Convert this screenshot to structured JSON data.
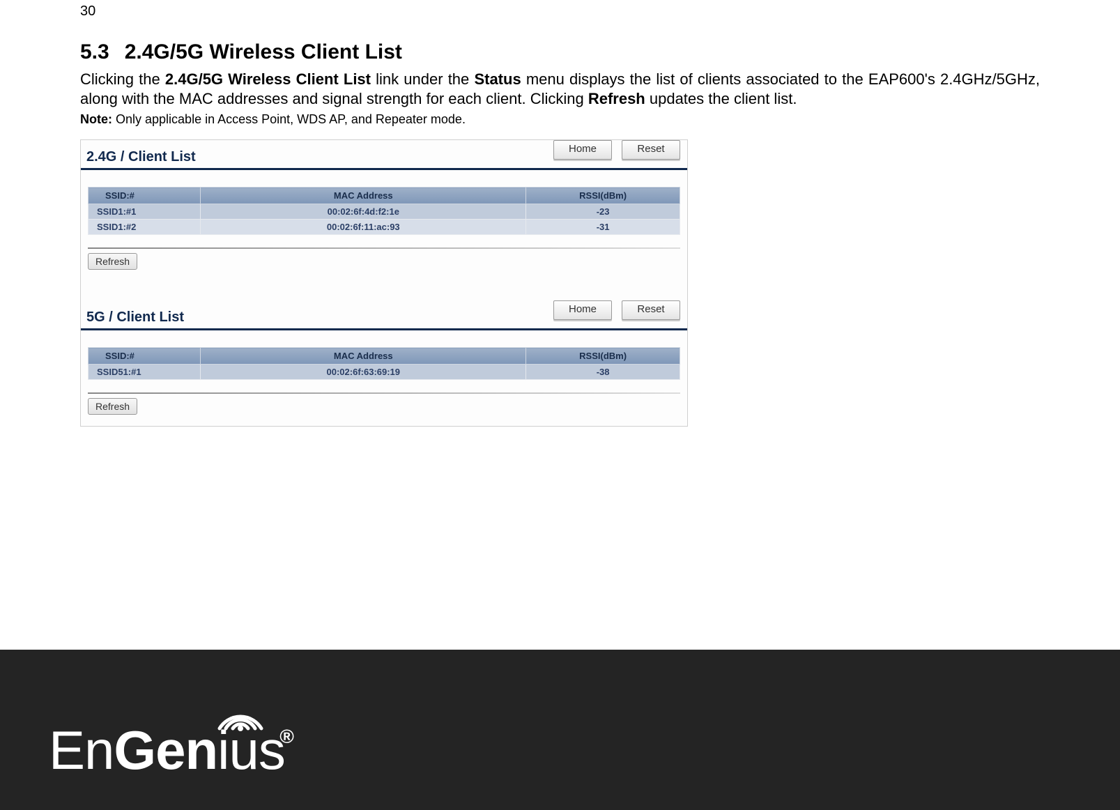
{
  "page_number": "30",
  "heading": {
    "num": "5.3",
    "title": "2.4G/5G Wireless Client List"
  },
  "body": {
    "p1a": "Clicking the ",
    "p1b": "2.4G/5G Wireless Client List",
    "p1c": " link under the ",
    "p1d": "Status",
    "p1e": " menu displays the list of clients associated to the EAP600's 2.4GHz/5GHz, along with the MAC addresses and signal strength for each client. Clicking ",
    "p1f": "Refresh",
    "p1g": " updates the client list."
  },
  "note": {
    "label": "Note:",
    "text": " Only applicable in Access Point, WDS AP, and Repeater mode."
  },
  "buttons": {
    "home": "Home",
    "reset": "Reset",
    "refresh": "Refresh"
  },
  "section_24g": {
    "title": "2.4G / Client List",
    "columns": {
      "ssid": "SSID:#",
      "mac": "MAC Address",
      "rssi": "RSSI(dBm)"
    },
    "rows": [
      {
        "ssid": "SSID1:#1",
        "mac": "00:02:6f:4d:f2:1e",
        "rssi": "-23"
      },
      {
        "ssid": "SSID1:#2",
        "mac": "00:02:6f:11:ac:93",
        "rssi": "-31"
      }
    ]
  },
  "section_5g": {
    "title": "5G / Client List",
    "columns": {
      "ssid": "SSID:#",
      "mac": "MAC Address",
      "rssi": "RSSI(dBm)"
    },
    "rows": [
      {
        "ssid": "SSID51:#1",
        "mac": "00:02:6f:63:69:19",
        "rssi": "-38"
      }
    ]
  },
  "logo_text": {
    "brand_a": "En",
    "brand_b": "Gen",
    "brand_c": "ius"
  }
}
